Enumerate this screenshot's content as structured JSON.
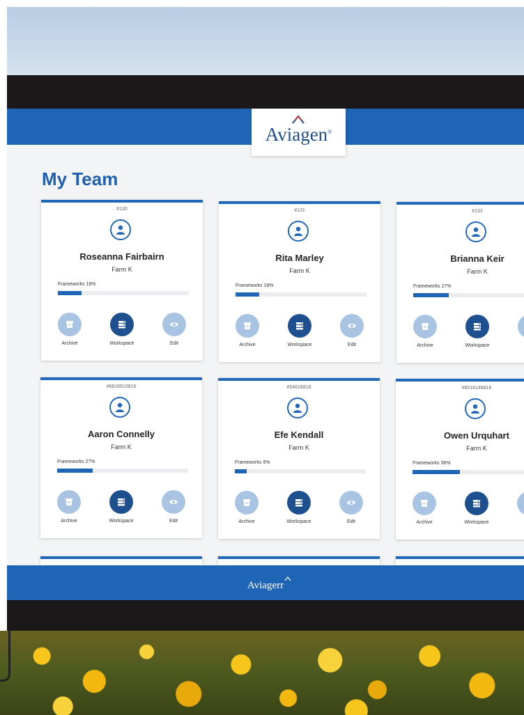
{
  "brand": {
    "name": "Aviagen",
    "registered_mark": "®",
    "footer_name": "Aviagerr"
  },
  "page": {
    "title": "My Team"
  },
  "progress_label": "Frameworks",
  "actions": {
    "archive": "Archive",
    "workspace": "Workspace",
    "edit": "Edit"
  },
  "cards": [
    {
      "id": "#130",
      "name": "Roseanna Fairbairn",
      "farm": "Farm K",
      "frameworks": "Frameworks 18%",
      "percent": 18
    },
    {
      "id": "#131",
      "name": "Rita Marley",
      "farm": "Farm K",
      "frameworks": "Frameworks 18%",
      "percent": 18
    },
    {
      "id": "#132",
      "name": "Brianna Keir",
      "farm": "Farm K",
      "frameworks": "Frameworks 27%",
      "percent": 27
    },
    {
      "id": "#6816816816",
      "name": "Aaron Connelly",
      "farm": "Farm K",
      "frameworks": "Frameworks 27%",
      "percent": 27
    },
    {
      "id": "#54616816",
      "name": "Efe Kendall",
      "farm": "Farm K",
      "frameworks": "Frameworks 9%",
      "percent": 9
    },
    {
      "id": "#6516146816",
      "name": "Owen Urquhart",
      "farm": "Farm K",
      "frameworks": "Frameworks 36%",
      "percent": 36
    }
  ],
  "colors": {
    "brand_blue": "#1f65b5",
    "navy": "#1e4f8f",
    "light_blue": "#a9c4e2",
    "background": "#f3f4f6"
  },
  "icons": {
    "avatar": "user-circle-icon",
    "archive": "archive-box-icon",
    "workspace": "workspace-server-icon",
    "edit": "eye-icon"
  }
}
